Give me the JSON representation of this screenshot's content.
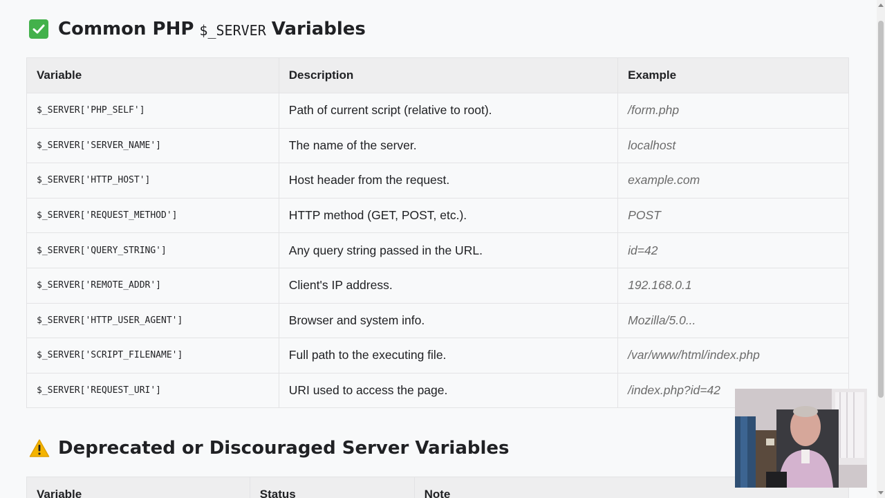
{
  "section1": {
    "title_prefix": "Common PHP",
    "title_code": "$_SERVER",
    "title_suffix": "Variables",
    "headers": [
      "Variable",
      "Description",
      "Example"
    ],
    "rows": [
      {
        "variable": "$_SERVER['PHP_SELF']",
        "description": "Path of current script (relative to root).",
        "example": "/form.php"
      },
      {
        "variable": "$_SERVER['SERVER_NAME']",
        "description": "The name of the server.",
        "example": "localhost"
      },
      {
        "variable": "$_SERVER['HTTP_HOST']",
        "description": "Host header from the request.",
        "example": "example.com"
      },
      {
        "variable": "$_SERVER['REQUEST_METHOD']",
        "description": "HTTP method (GET, POST, etc.).",
        "example": "POST"
      },
      {
        "variable": "$_SERVER['QUERY_STRING']",
        "description": "Any query string passed in the URL.",
        "example": "id=42"
      },
      {
        "variable": "$_SERVER['REMOTE_ADDR']",
        "description": "Client's IP address.",
        "example": "192.168.0.1"
      },
      {
        "variable": "$_SERVER['HTTP_USER_AGENT']",
        "description": "Browser and system info.",
        "example": "Mozilla/5.0..."
      },
      {
        "variable": "$_SERVER['SCRIPT_FILENAME']",
        "description": "Full path to the executing file.",
        "example": "/var/www/html/index.php"
      },
      {
        "variable": "$_SERVER['REQUEST_URI']",
        "description": "URI used to access the page.",
        "example": "/index.php?id=42"
      }
    ]
  },
  "section2": {
    "title": "Deprecated or Discouraged Server Variables",
    "headers": [
      "Variable",
      "Status",
      "Note"
    ]
  },
  "icons": {
    "section1": "check-mark-icon",
    "section2": "warning-icon"
  },
  "colors": {
    "check_green": "#43b14b",
    "warning_yellow": "#f4b400",
    "example_text": "#6b6b6b"
  }
}
